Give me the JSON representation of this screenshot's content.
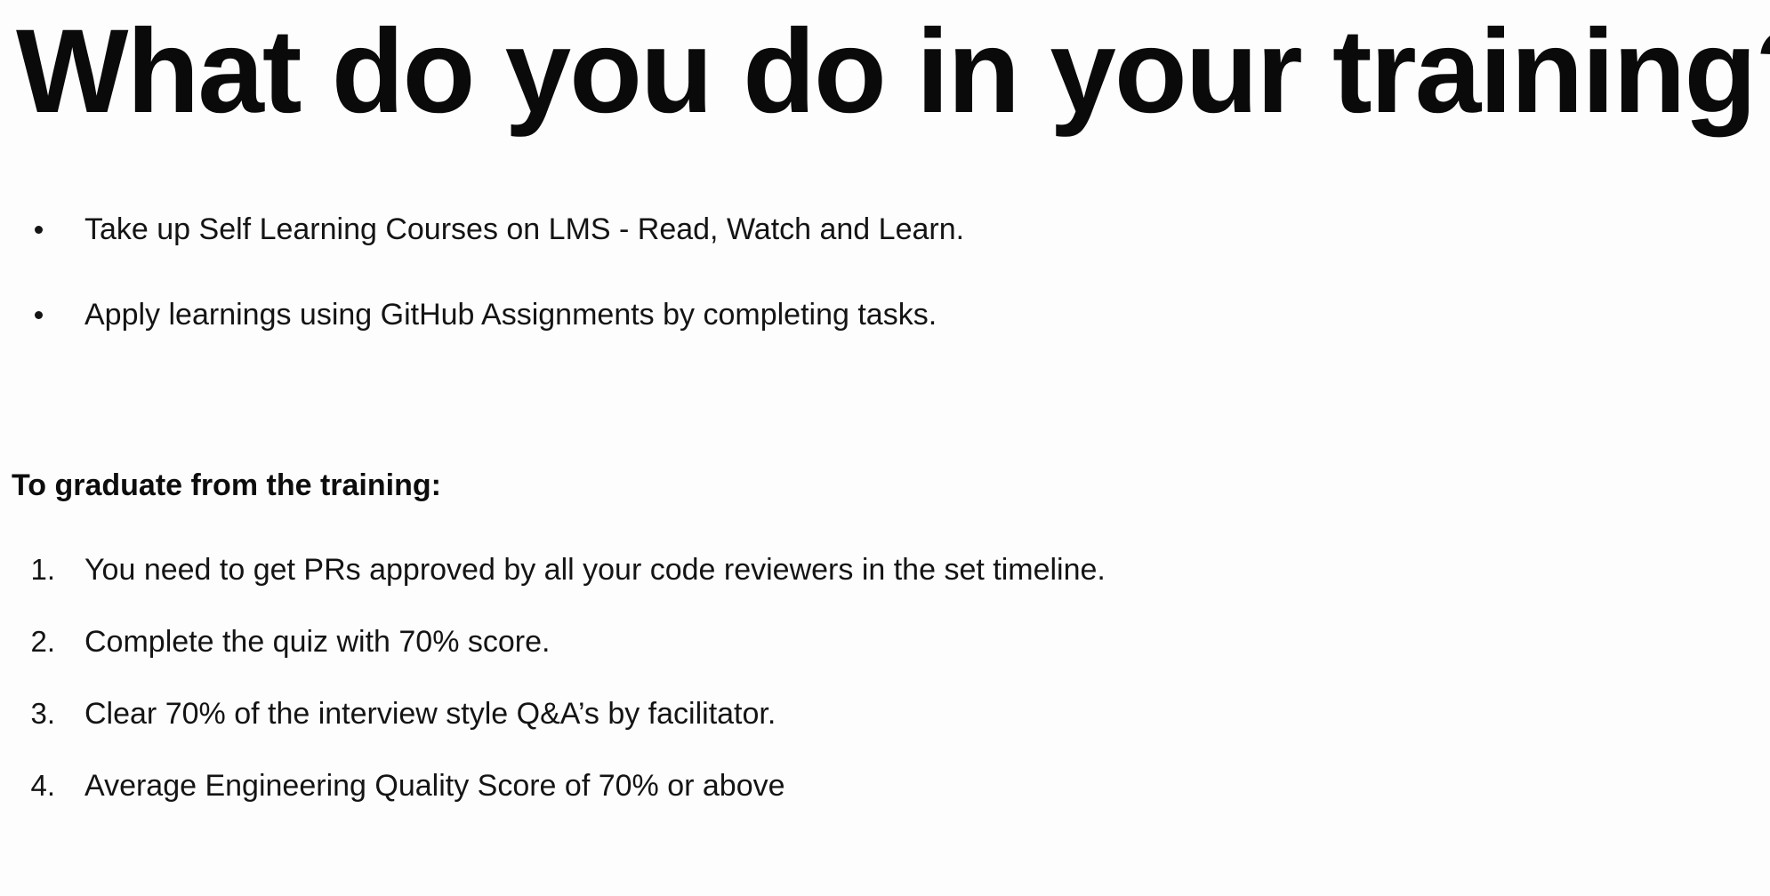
{
  "title": "What do you do in your training?",
  "activities": [
    "Take up Self Learning Courses on LMS - Read, Watch and Learn.",
    "Apply learnings using GitHub Assignments by completing tasks."
  ],
  "graduation": {
    "heading": "To graduate from the training:",
    "items": [
      {
        "number": "1.",
        "text": "You need to get PRs approved by all your code reviewers in the set timeline."
      },
      {
        "number": "2.",
        "text": "Complete the quiz with 70% score."
      },
      {
        "number": "3.",
        "text": "Clear 70% of the interview style Q&A’s by facilitator."
      },
      {
        "number": "4.",
        "text": "Average Engineering Quality Score of 70% or above"
      }
    ]
  }
}
